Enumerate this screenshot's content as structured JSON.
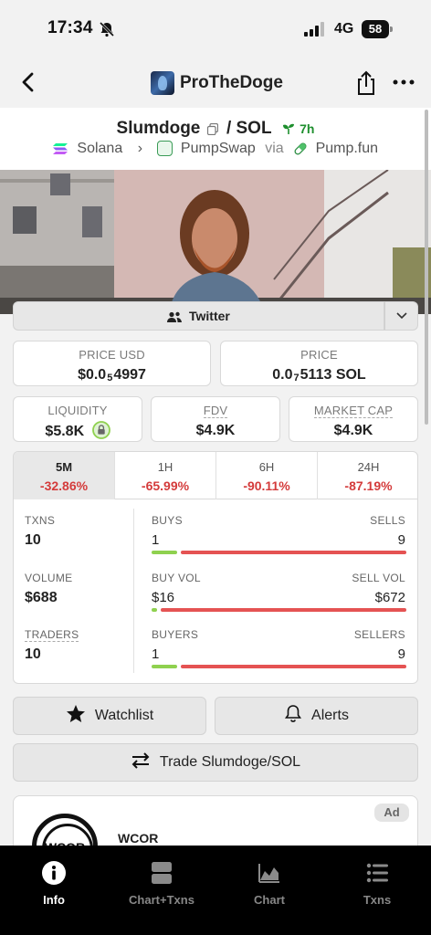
{
  "status_bar": {
    "time": "17:34",
    "network": "4G",
    "battery": "58"
  },
  "nav": {
    "title": "ProTheDoge"
  },
  "token": {
    "name": "Slumdoge",
    "quote": "SOL",
    "separator": "/",
    "age": "7h",
    "chain": "Solana",
    "dex": "PumpSwap",
    "via": "via",
    "launchpad": "Pump.fun"
  },
  "social": {
    "twitter_label": "Twitter"
  },
  "prices": {
    "price_usd_label": "PRICE USD",
    "price_usd_prefix": "$0.0",
    "price_usd_sub": "5",
    "price_usd_suffix": "4997",
    "price_label": "PRICE",
    "price_prefix": "0.0",
    "price_sub": "7",
    "price_suffix": "5113 SOL"
  },
  "metrics": {
    "liquidity_label": "LIQUIDITY",
    "liquidity_value": "$5.8K",
    "fdv_label": "FDV",
    "fdv_value": "$4.9K",
    "mcap_label": "MARKET CAP",
    "mcap_value": "$4.9K"
  },
  "timeframes": [
    {
      "label": "5M",
      "change": "-32.86%"
    },
    {
      "label": "1H",
      "change": "-65.99%"
    },
    {
      "label": "6H",
      "change": "-90.11%"
    },
    {
      "label": "24H",
      "change": "-87.19%"
    }
  ],
  "stats": {
    "txns_label": "TXNS",
    "txns_value": "10",
    "volume_label": "VOLUME",
    "volume_value": "$688",
    "traders_label": "TRADERS",
    "traders_value": "10",
    "buys_label": "BUYS",
    "buys_value": "1",
    "sells_label": "SELLS",
    "sells_value": "9",
    "buy_vol_label": "BUY VOL",
    "buy_vol_value": "$16",
    "sell_vol_label": "SELL VOL",
    "sell_vol_value": "$672",
    "buyers_label": "BUYERS",
    "buyers_value": "1",
    "sellers_label": "SELLERS",
    "sellers_value": "9",
    "buys_ratio": 0.1,
    "buy_vol_ratio": 0.023,
    "buyers_ratio": 0.1
  },
  "actions": {
    "watchlist_label": "Watchlist",
    "alerts_label": "Alerts",
    "trade_label": "Trade Slumdoge/SOL"
  },
  "ad": {
    "badge": "Ad",
    "logo_text": "WCOR",
    "name": "WCOR"
  },
  "tabbar": [
    {
      "label": "Info",
      "icon": "info-icon",
      "active": true
    },
    {
      "label": "Chart+Txns",
      "icon": "split-panel-icon",
      "active": false
    },
    {
      "label": "Chart",
      "icon": "area-chart-icon",
      "active": false
    },
    {
      "label": "Txns",
      "icon": "list-icon",
      "active": false
    }
  ],
  "colors": {
    "positive": "#8fd14f",
    "negative": "#e55353",
    "accent_green": "#1e8f2e"
  }
}
